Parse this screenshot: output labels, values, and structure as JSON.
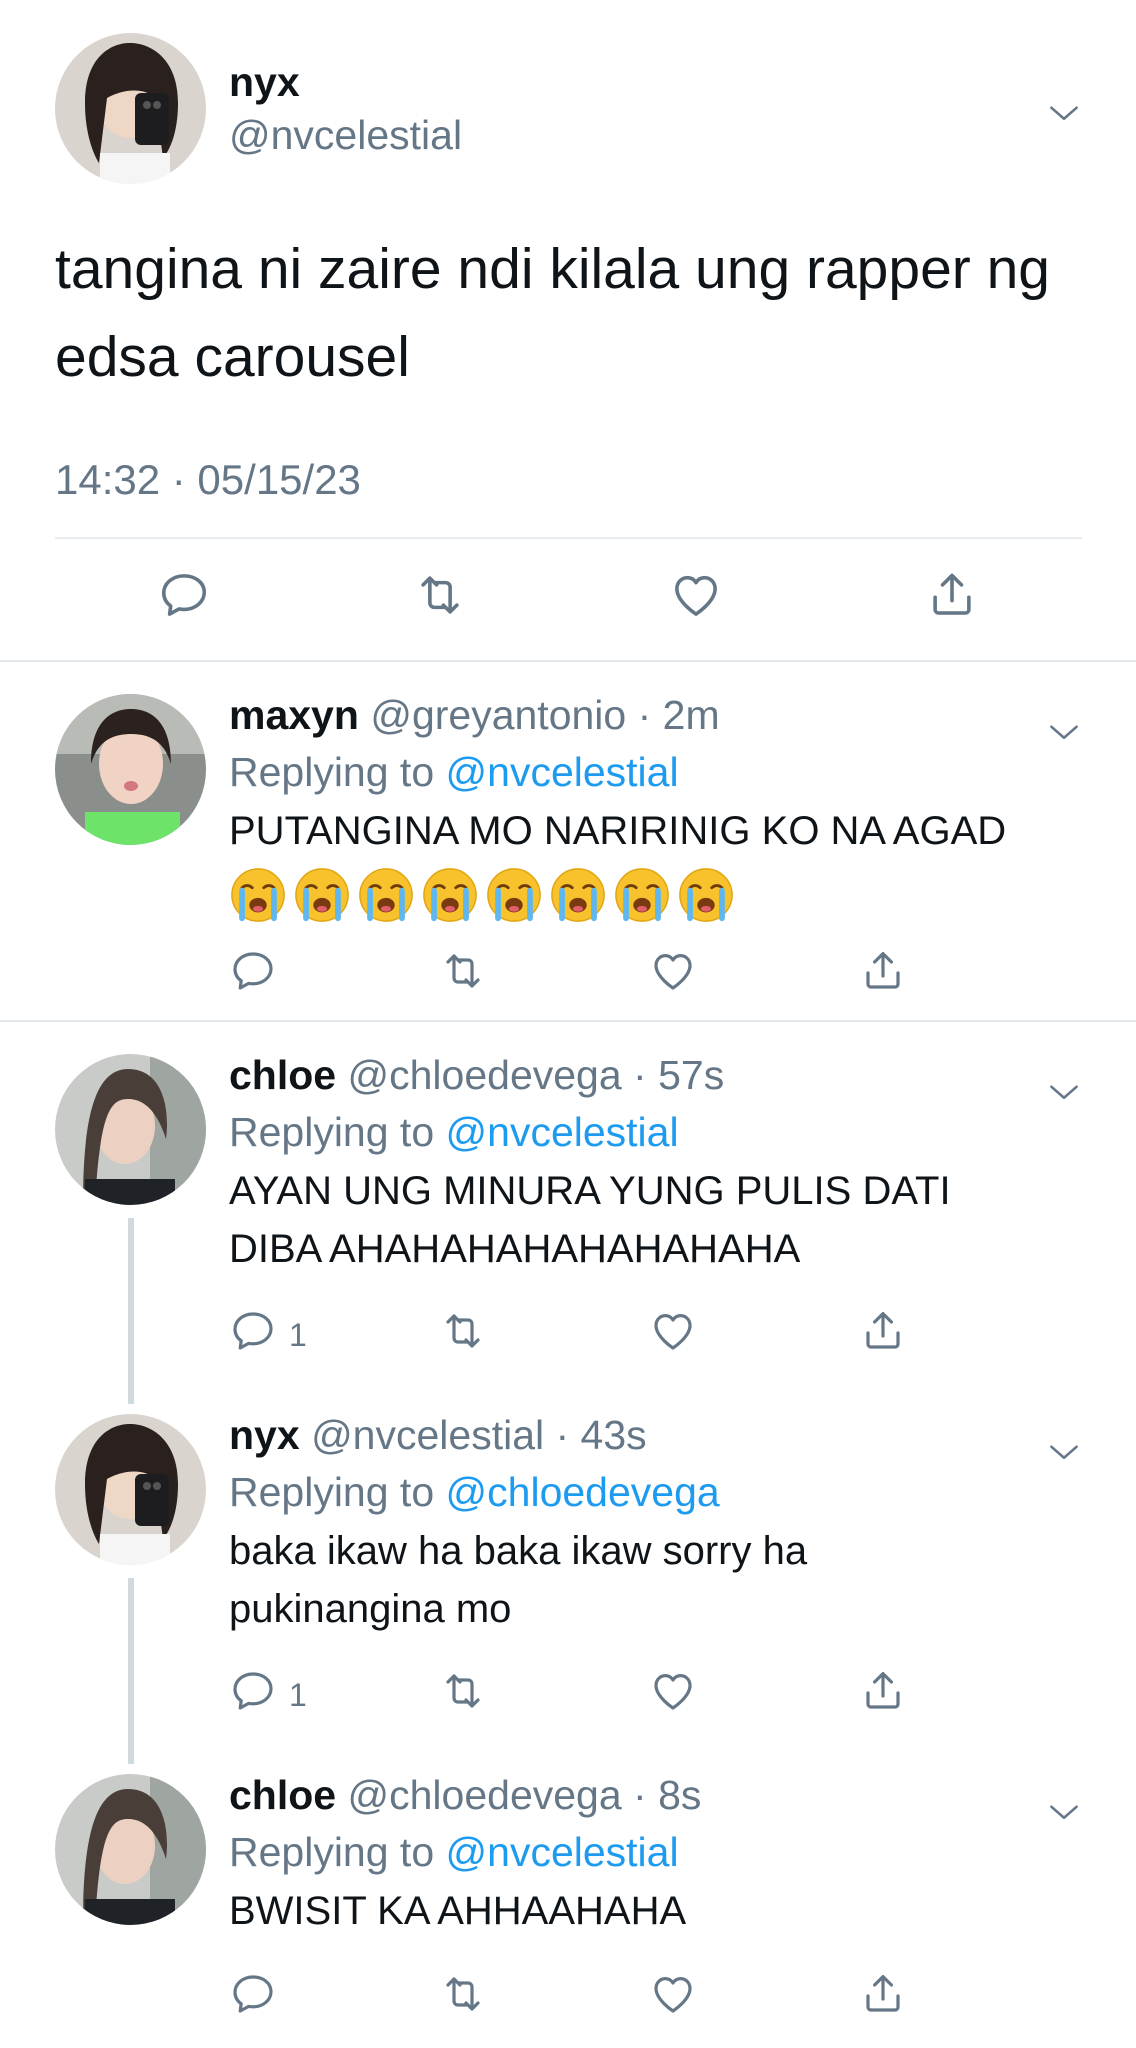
{
  "main_tweet": {
    "name": "nyx",
    "handle": "@nvcelestial",
    "text": "tangina ni zaire ndi kilala ung rapper ng edsa carousel",
    "timestamp": "14:32 · 05/15/23"
  },
  "replies": [
    {
      "name": "maxyn",
      "handle_time": "@greyantonio · 2m",
      "replying_prefix": "Replying to",
      "replying_to": "@nvcelestial",
      "text": "PUTANGINA MO NARIRINIG KO NA AGAD",
      "emoji": [
        "loudly-crying-face",
        "loudly-crying-face",
        "loudly-crying-face",
        "loudly-crying-face",
        "loudly-crying-face",
        "loudly-crying-face",
        "loudly-crying-face",
        "loudly-crying-face"
      ],
      "reply_count": ""
    },
    {
      "name": "chloe",
      "handle_time": "@chloedevega · 57s",
      "replying_prefix": "Replying to",
      "replying_to": "@nvcelestial",
      "text": "AYAN UNG MINURA YUNG PULIS DATI DIBA AHAHAHAHAHAHAHAHA",
      "reply_count": "1"
    },
    {
      "name": "nyx",
      "handle_time": "@nvcelestial · 43s",
      "replying_prefix": "Replying to",
      "replying_to": "@chloedevega",
      "text": "baka ikaw ha baka ikaw sorry ha pukinangina mo",
      "reply_count": "1"
    },
    {
      "name": "chloe",
      "handle_time": "@chloedevega · 8s",
      "replying_prefix": "Replying to",
      "replying_to": "@nvcelestial",
      "text": "BWISIT KA AHHAAHAHA",
      "reply_count": ""
    }
  ],
  "colors": {
    "link": "#1d9bf0",
    "secondary_text": "#657786",
    "divider": "#e1e8ed",
    "thread_line": "#cfd9de"
  },
  "icons": [
    "chevron-down-icon",
    "reply-icon",
    "retweet-icon",
    "like-icon",
    "share-icon"
  ]
}
